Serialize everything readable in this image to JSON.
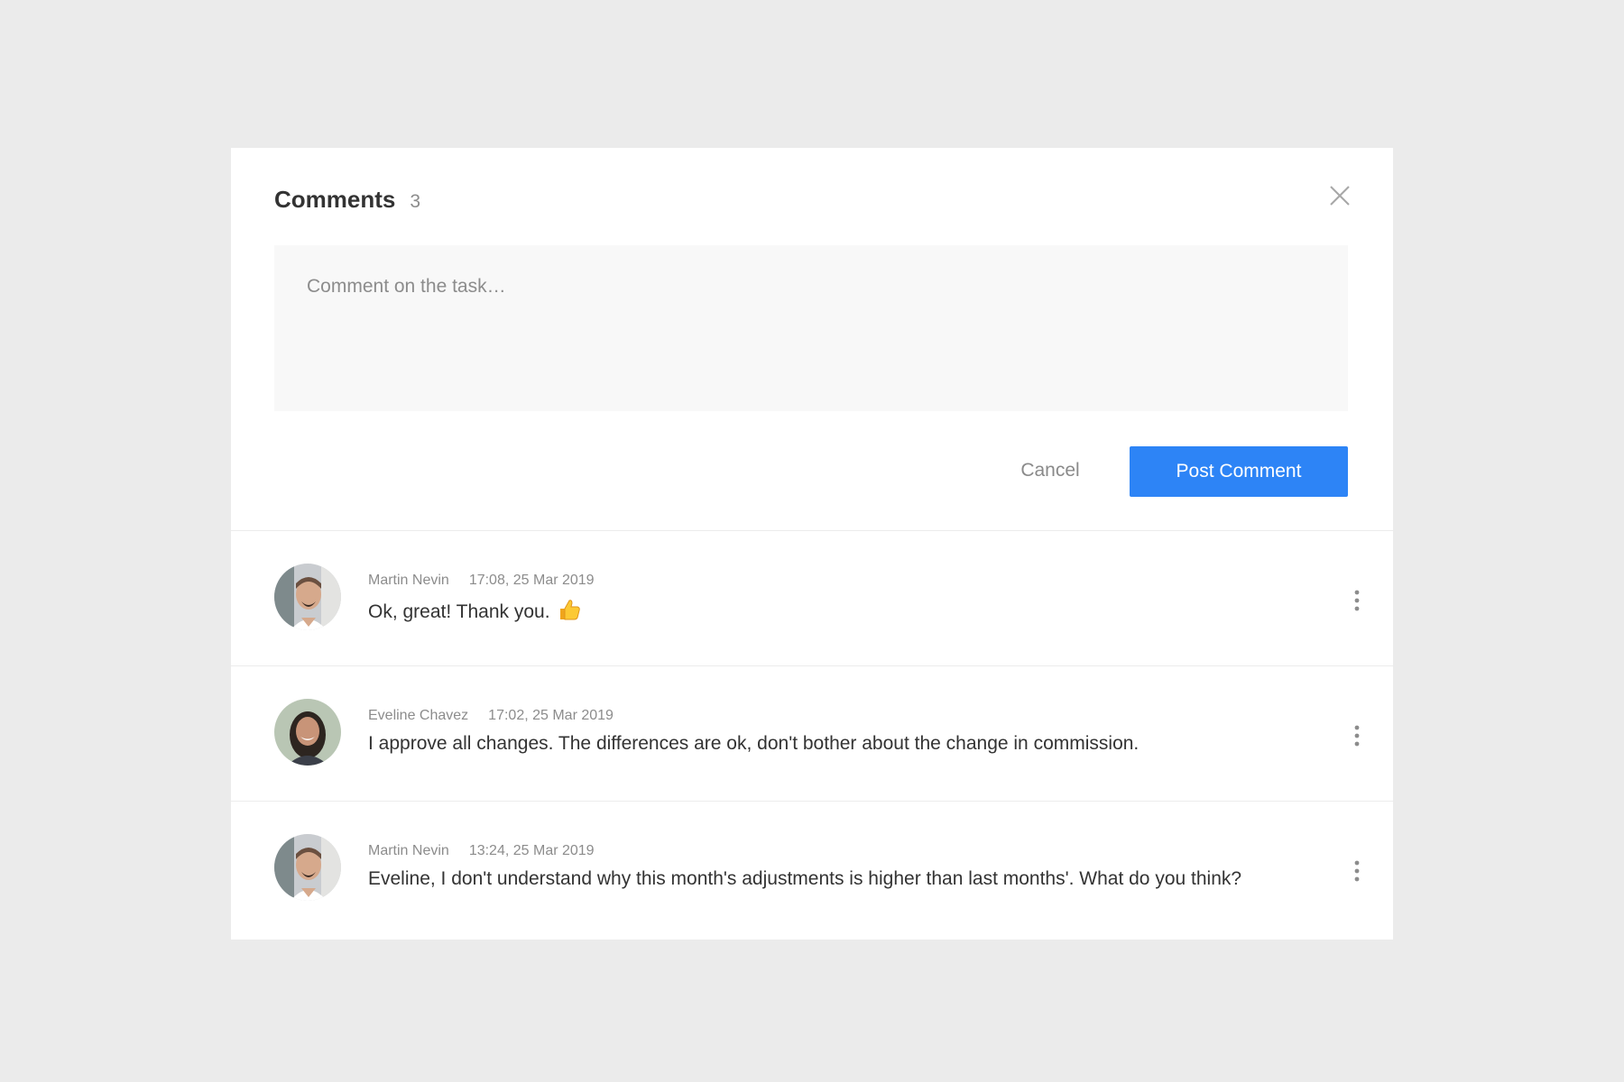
{
  "header": {
    "title": "Comments",
    "count": "3"
  },
  "composer": {
    "placeholder": "Comment on the task…",
    "cancel_label": "Cancel",
    "post_label": "Post Comment"
  },
  "colors": {
    "accent": "#2d84f6",
    "background": "#ebebeb"
  },
  "comments": [
    {
      "author": "Martin Nevin",
      "time": "17:08, 25 Mar 2019",
      "text": "Ok, great! Thank you.",
      "emoji": "thumbs-up-icon",
      "avatar": "avatar-martin"
    },
    {
      "author": "Eveline Chavez",
      "time": "17:02, 25 Mar 2019",
      "text": "I approve all changes. The differences are ok, don't bother about the change in commission.",
      "avatar": "avatar-eveline"
    },
    {
      "author": "Martin Nevin",
      "time": "13:24, 25 Mar 2019",
      "text": "Eveline, I don't understand why this month's adjustments is higher than last months'. What do you think?",
      "avatar": "avatar-martin"
    }
  ]
}
